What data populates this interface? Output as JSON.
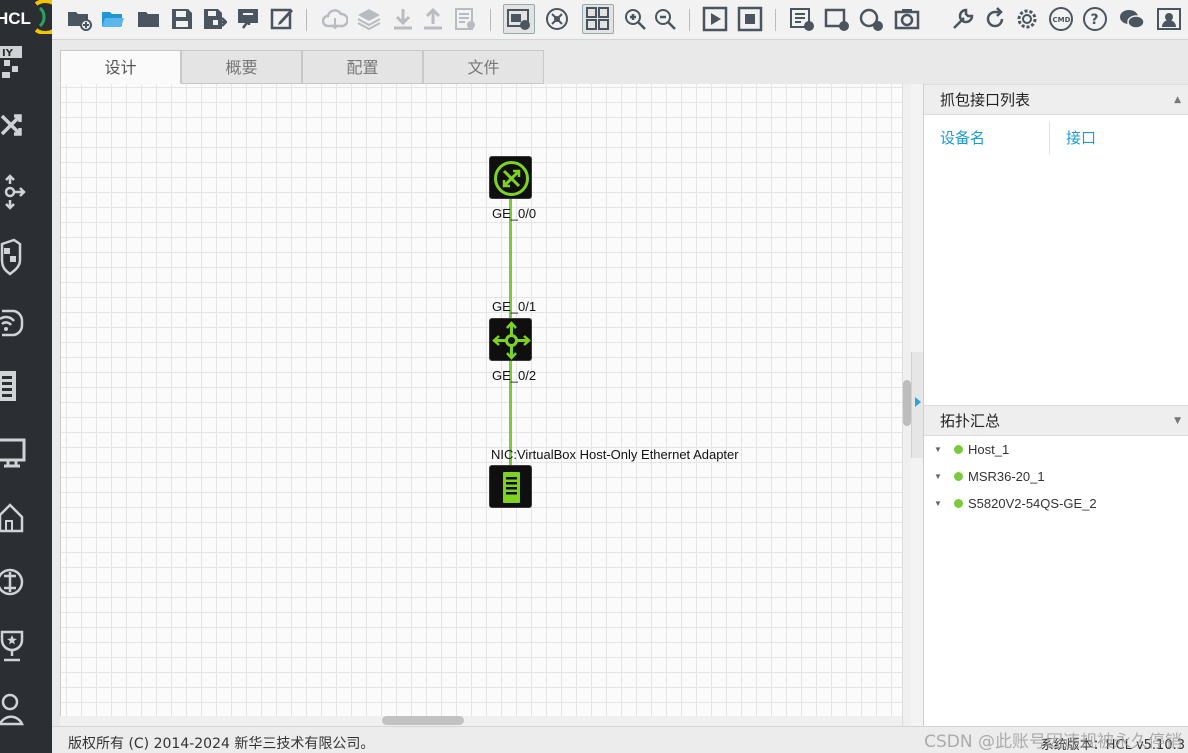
{
  "app": {
    "logo_text": "HCL"
  },
  "toolbar": {
    "icons": [
      "new-project-icon",
      "open-folder-icon",
      "open-recent-icon",
      "save-icon",
      "save-as-icon",
      "import-icon",
      "edit-icon",
      "cloud-icon",
      "layers-icon",
      "download-icon",
      "upload-icon",
      "log-icon",
      "screenshot-icon",
      "topology-icon",
      "grid-icon",
      "zoom-in-icon",
      "zoom-out-icon",
      "play-icon",
      "stop-icon",
      "add-text-icon",
      "add-rect-icon",
      "add-ellipse-icon",
      "camera-icon",
      "tool-icon",
      "refresh-icon",
      "gear-icon",
      "cmd-icon",
      "help-icon",
      "wechat-icon",
      "user-icon"
    ]
  },
  "tabs": [
    {
      "label": "设计",
      "selected": true
    },
    {
      "label": "概要",
      "selected": false
    },
    {
      "label": "配置",
      "selected": false
    },
    {
      "label": "文件",
      "selected": false
    }
  ],
  "topology": {
    "ports": {
      "router_port": "GE_0/0",
      "switch_port_up": "GE_0/1",
      "switch_port_down": "GE_0/2",
      "host_nic": "NIC:VirtualBox Host-Only Ethernet Adapter"
    },
    "link_color": "#7acb3c",
    "device_icon_color": "#7ed321"
  },
  "right_panel": {
    "capture": {
      "title": "抓包接口列表",
      "col_device": "设备名",
      "col_interface": "接口"
    },
    "summary": {
      "title": "拓扑汇总",
      "items": [
        "Host_1",
        "MSR36-20_1",
        "S5820V2-54QS-GE_2"
      ]
    }
  },
  "status": {
    "copyright": "版权所有 (C) 2014-2024 新华三技术有限公司。",
    "version": "系统版本：HCL v5.10.3",
    "watermark": "CSDN @此账号因违规被永久停销"
  }
}
